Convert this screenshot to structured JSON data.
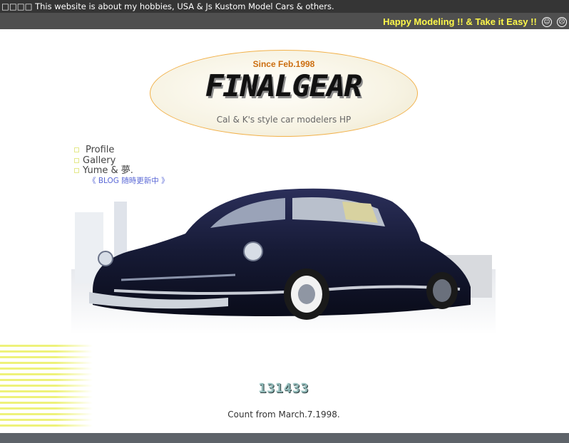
{
  "top_bar": {
    "text": "□□□□ This website is about my hobbies, USA & Js Kustom Model Cars & others."
  },
  "tag_bar": {
    "text": "Happy Modeling !! & Take it Easy !!",
    "icons": [
      "smile-icon",
      "smile-icon"
    ]
  },
  "logo": {
    "since": "Since Feb.1998",
    "brand": "FINALGEAR",
    "subtitle": "Cal & K's style car modelers HP"
  },
  "nav": {
    "items": [
      {
        "label": "Profile"
      },
      {
        "label": "Gallery"
      },
      {
        "label": "Yume & 夢."
      }
    ],
    "blog_link": "《 BLOG 随時更新中 》"
  },
  "counter": {
    "value": "131433",
    "caption": "Count from March.7.1998."
  },
  "colors": {
    "top_bar_bg": "#353535",
    "tag_bar_bg": "#4f4f4f",
    "tag_text": "#fff84a",
    "since_text": "#cc6e10",
    "blog_link": "#5a68d6",
    "stripe": "#eef27a",
    "bottom_bar": "#5e6369"
  }
}
